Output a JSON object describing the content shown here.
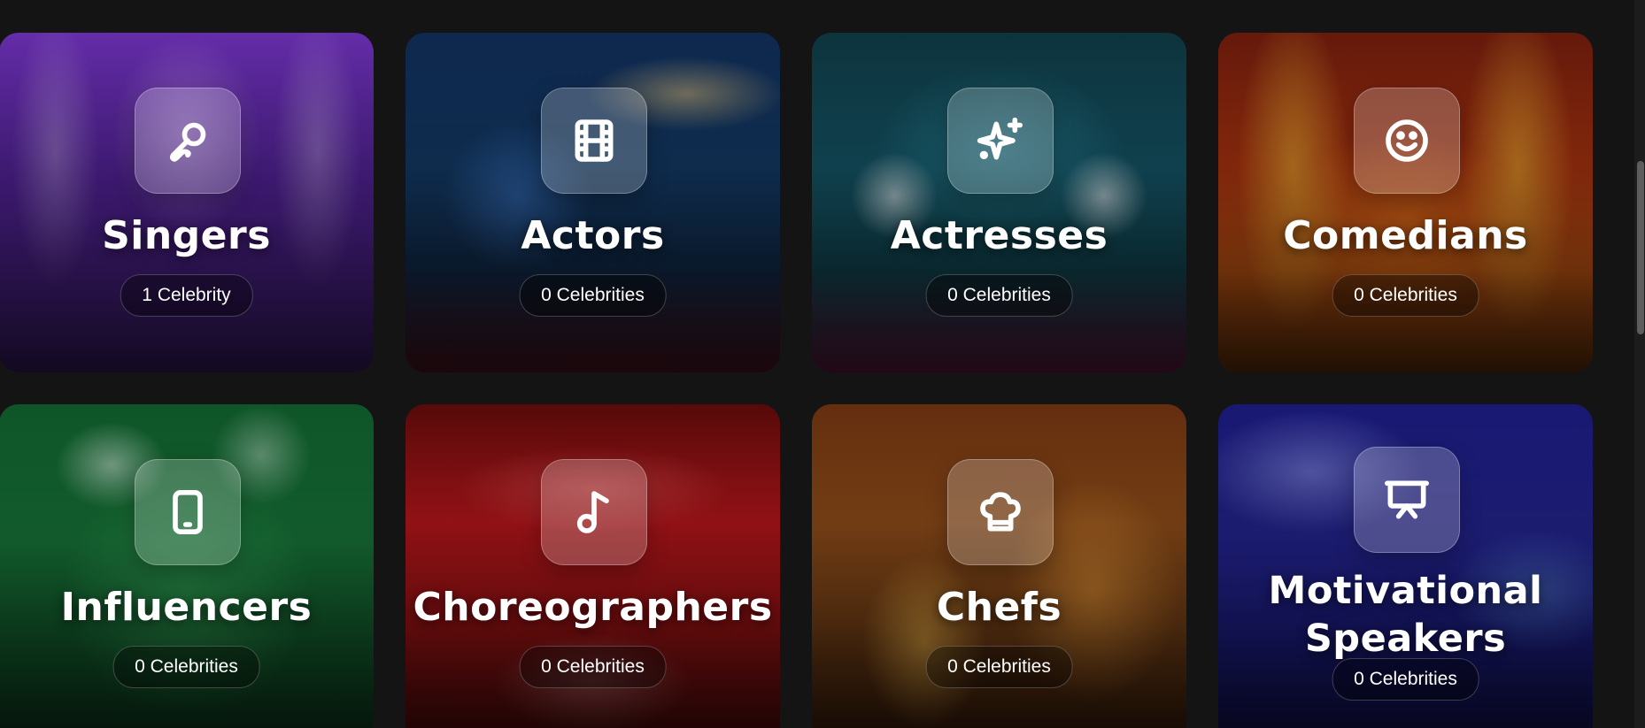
{
  "categories": [
    {
      "name": "Singers",
      "count_label": "1 Celebrity",
      "icon": "microphone-icon"
    },
    {
      "name": "Actors",
      "count_label": "0 Celebrities",
      "icon": "film-icon"
    },
    {
      "name": "Actresses",
      "count_label": "0 Celebrities",
      "icon": "sparkles-icon"
    },
    {
      "name": "Comedians",
      "count_label": "0 Celebrities",
      "icon": "smiley-icon"
    },
    {
      "name": "Influencers",
      "count_label": "0 Celebrities",
      "icon": "smartphone-icon"
    },
    {
      "name": "Choreographers",
      "count_label": "0 Celebrities",
      "icon": "music-note-icon"
    },
    {
      "name": "Chefs",
      "count_label": "0 Celebrities",
      "icon": "chef-hat-icon"
    },
    {
      "name": "Motivational Speakers",
      "count_label": "0 Celebrities",
      "icon": "presentation-icon"
    }
  ],
  "theme": {
    "page_background": "#141414",
    "text": "#ffffff"
  }
}
